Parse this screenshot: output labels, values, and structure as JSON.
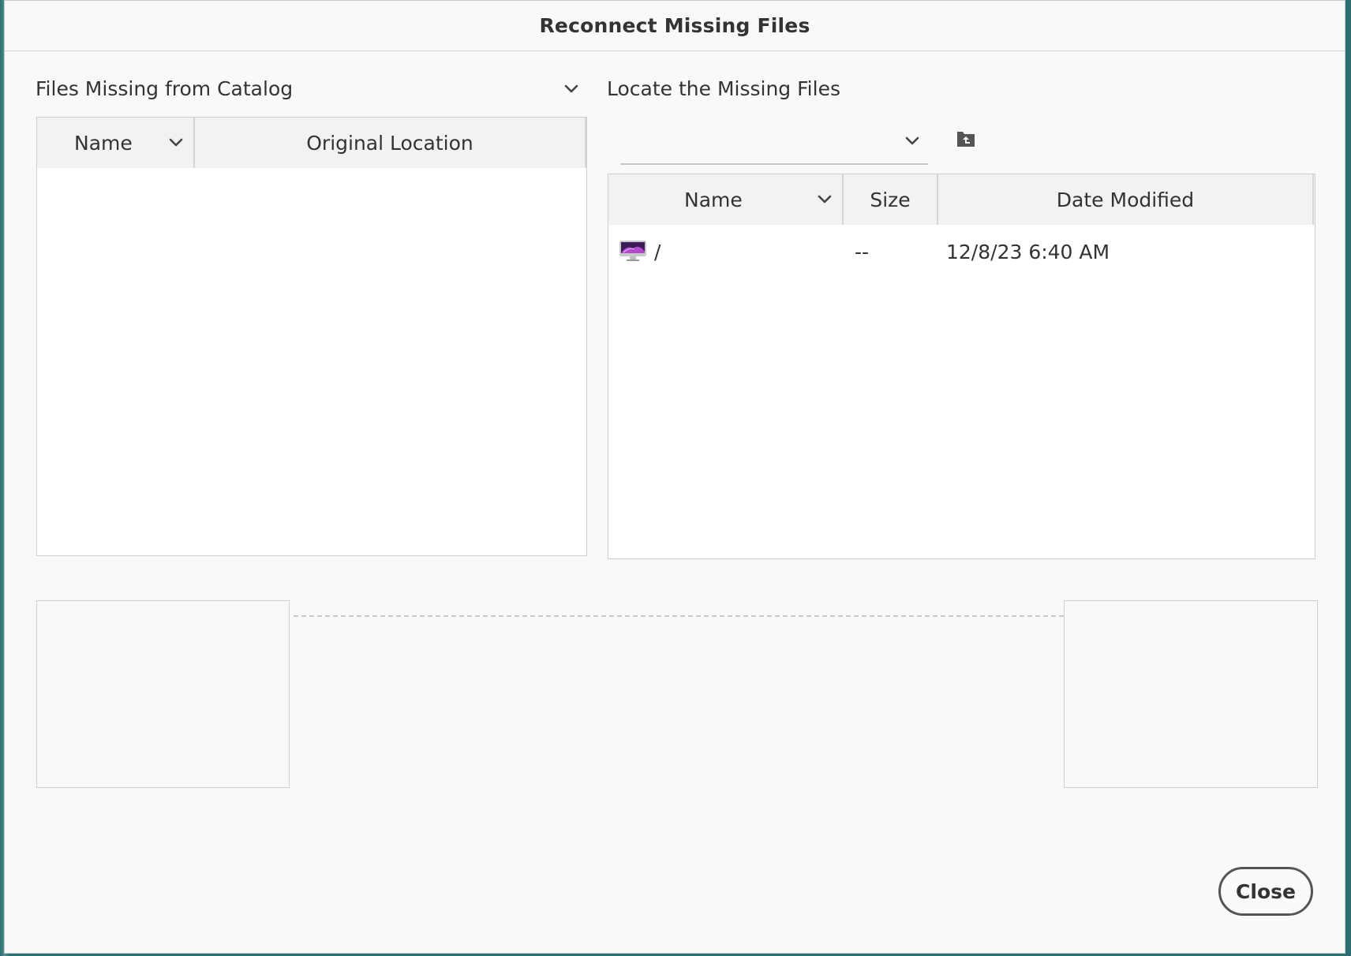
{
  "dialog": {
    "title": "Reconnect Missing Files"
  },
  "missing": {
    "label": "Files Missing from Catalog",
    "columns": [
      "Name",
      "Original Location"
    ]
  },
  "locate": {
    "label": "Locate the Missing Files",
    "path_value": "",
    "columns": [
      "Name",
      "Size",
      "Date Modified"
    ],
    "rows": [
      {
        "icon": "computer-icon",
        "name": "/",
        "size": "--",
        "date": "12/8/23 6:40 AM"
      }
    ]
  },
  "buttons": {
    "close": "Close"
  }
}
